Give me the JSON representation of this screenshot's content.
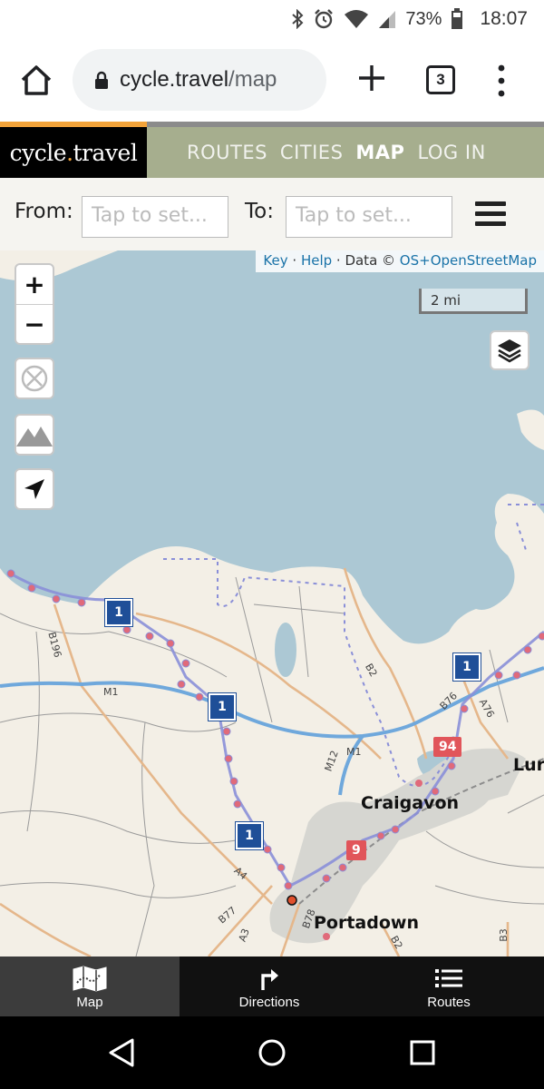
{
  "status_bar": {
    "battery_pct": "73%",
    "time": "18:07"
  },
  "browser": {
    "url_host": "cycle.travel",
    "url_path": "/map",
    "tab_count": "3"
  },
  "site": {
    "logo_part1": "cycle",
    "logo_dot": ".",
    "logo_part2": "travel",
    "nav": [
      "ROUTES",
      "CITIES",
      "MAP",
      "LOG IN"
    ],
    "active_nav": "MAP"
  },
  "route_form": {
    "from_label": "From:",
    "from_placeholder": "Tap to set...",
    "to_label": "To:",
    "to_placeholder": "Tap to set..."
  },
  "map": {
    "attribution": {
      "key": "Key",
      "sep1": " · ",
      "help": "Help",
      "sep2": " · Data © ",
      "data": "OS+OpenStreetMap"
    },
    "scale": "2 mi",
    "zoom_in": "+",
    "zoom_out": "−",
    "places": {
      "craigavon": "Craigavon",
      "portadown": "Portadown",
      "lurgan": "Lur"
    },
    "road_labels": {
      "b196": "B196",
      "m1a": "M1",
      "m1b": "M1",
      "m12": "M12",
      "b2a": "B2",
      "b76": "B76",
      "a76": "A76",
      "a4": "A4",
      "b77": "B77",
      "a3": "A3",
      "b78": "B78",
      "b2b": "B2",
      "b3": "B3"
    },
    "ncn_number": "1",
    "shields": {
      "s94": "94",
      "s9": "9"
    },
    "colors": {
      "water": "#acc8d4",
      "land": "#f3efe6",
      "motorway": "#6fa8dc",
      "route": "#8a8fd8",
      "urban": "#d6d6d1",
      "shield": "#e1555a",
      "ncn": "#1f4f98"
    }
  },
  "bottom_tabs": [
    {
      "label": "Map",
      "icon": "folded-map-icon",
      "active": true
    },
    {
      "label": "Directions",
      "icon": "turn-right-icon",
      "active": false
    },
    {
      "label": "Routes",
      "icon": "list-icon",
      "active": false
    }
  ]
}
